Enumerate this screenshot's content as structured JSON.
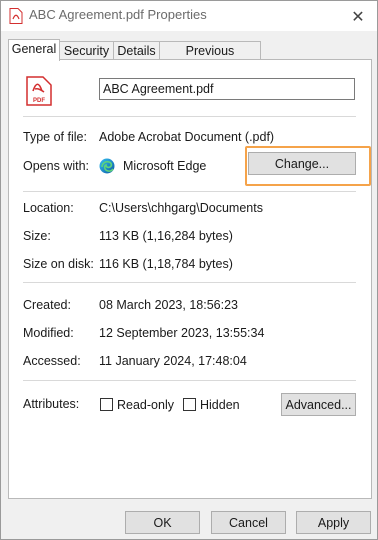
{
  "window": {
    "title": "ABC Agreement.pdf Properties",
    "close_glyph": "✕"
  },
  "tabs": [
    {
      "label": "General",
      "active": true
    },
    {
      "label": "Security",
      "active": false
    },
    {
      "label": "Details",
      "active": false
    },
    {
      "label": "Previous Versions",
      "active": false
    }
  ],
  "general": {
    "pdf_icon_text": "PDF",
    "filename_value": "ABC Agreement.pdf",
    "type_label": "Type of file:",
    "type_value": "Adobe Acrobat Document (.pdf)",
    "opens_label": "Opens with:",
    "opens_value": "Microsoft Edge",
    "change_button": "Change...",
    "location_label": "Location:",
    "location_value": "C:\\Users\\chhgarg\\Documents",
    "size_label": "Size:",
    "size_value": "113 KB (1,16,284 bytes)",
    "size_on_disk_label": "Size on disk:",
    "size_on_disk_value": "116 KB (1,18,784 bytes)",
    "created_label": "Created:",
    "created_value": "08 March 2023, 18:56:23",
    "modified_label": "Modified:",
    "modified_value": "12 September 2023, 13:55:34",
    "accessed_label": "Accessed:",
    "accessed_value": "11 January 2024, 17:48:04",
    "attributes_label": "Attributes:",
    "readonly_label": "Read-only",
    "readonly_checked": false,
    "hidden_label": "Hidden",
    "hidden_checked": false,
    "advanced_button": "Advanced..."
  },
  "footer": {
    "ok": "OK",
    "cancel": "Cancel",
    "apply": "Apply"
  },
  "colors": {
    "pdf_red": "#d32f2f",
    "highlight_orange": "#f5a34a"
  }
}
